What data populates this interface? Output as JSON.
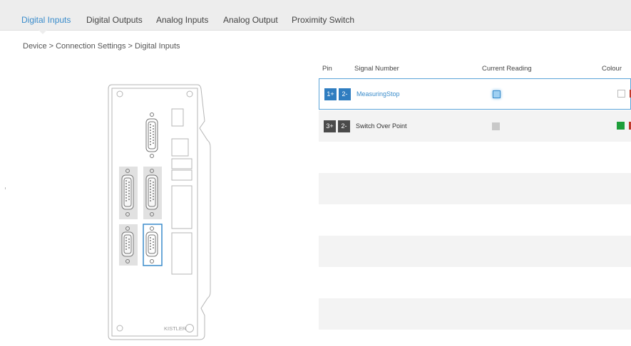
{
  "tabs": [
    {
      "label": "Digital Inputs",
      "active": true
    },
    {
      "label": "Digital Outputs",
      "active": false
    },
    {
      "label": "Analog Inputs",
      "active": false
    },
    {
      "label": "Analog Output",
      "active": false
    },
    {
      "label": "Proximity Switch",
      "active": false
    }
  ],
  "breadcrumb": {
    "items": [
      "Device",
      "Connection Settings",
      "Digital Inputs"
    ],
    "separator": ">"
  },
  "device": {
    "brand": "KISTLER"
  },
  "table": {
    "headers": {
      "pin": "Pin",
      "signal": "Signal Number",
      "reading": "Current Reading",
      "colour": "Colour"
    },
    "rows": [
      {
        "pin_plus": "1+",
        "pin_minus": "2-",
        "signal": "MeasuringStop",
        "reading_active": true,
        "colours": [
          "#ffffff",
          "#c0392b"
        ],
        "selected": true
      },
      {
        "pin_plus": "3+",
        "pin_minus": "2-",
        "signal": "Switch Over Point",
        "reading_active": false,
        "colours": [
          "#1e9e3a",
          "#c0392b"
        ],
        "selected": false
      }
    ]
  },
  "colors": {
    "accent": "#3a8ccb",
    "pin_active": "#2f7dc0",
    "pin_inactive": "#4a4a4a"
  }
}
